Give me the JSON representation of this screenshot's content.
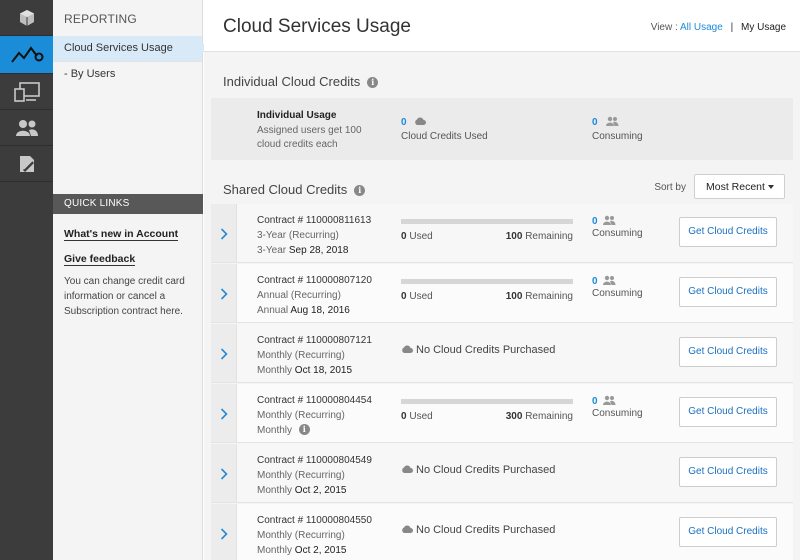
{
  "header": {
    "title": "Cloud Services Usage"
  },
  "view": {
    "prefix": "View :",
    "all_usage": "All Usage",
    "separator": "|",
    "my_usage": "My Usage"
  },
  "nav": {
    "heading": "REPORTING",
    "items": [
      {
        "label": "Cloud Services Usage"
      },
      {
        "label": "- By Users"
      }
    ],
    "quick_links": {
      "heading": "QUICK LINKS",
      "whats_new": "What's new in Account",
      "feedback": "Give feedback",
      "text": "You can change credit card information or cancel a Subscription contract here."
    }
  },
  "rail_icons": [
    "box-icon",
    "activity-icon",
    "devices-icon",
    "users-icon",
    "document-edit-icon"
  ],
  "individual": {
    "title": "Individual Cloud Credits",
    "label": "Individual Usage",
    "description": "Assigned users get 100 cloud credits each",
    "used_value": "0",
    "used_label": "Cloud Credits Used",
    "consuming_value": "0",
    "consuming_label": "Consuming"
  },
  "shared": {
    "title": "Shared Cloud Credits",
    "sort_label": "Sort by",
    "sort_value": "Most Recent",
    "rows": [
      {
        "contract": "Contract # 110000811613",
        "term": "3-Year (Recurring)",
        "date_prefix": "3-Year",
        "date": "Sep 28, 2018",
        "used": "0",
        "used_label": "Used",
        "remaining": "100",
        "remaining_label": "Remaining",
        "consuming": "0",
        "consuming_label": "Consuming",
        "button": "Get Cloud Credits"
      },
      {
        "contract": "Contract # 110000807120",
        "term": "Annual (Recurring)",
        "date_prefix": "Annual",
        "date": "Aug 18, 2016",
        "used": "0",
        "used_label": "Used",
        "remaining": "100",
        "remaining_label": "Remaining",
        "consuming": "0",
        "consuming_label": "Consuming",
        "button": "Get Cloud Credits"
      },
      {
        "contract": "Contract # 110000807121",
        "term": "Monthly (Recurring)",
        "date_prefix": "Monthly",
        "date": "Oct 18, 2015",
        "no_credits": "No Cloud Credits Purchased",
        "button": "Get Cloud Credits"
      },
      {
        "contract": "Contract # 110000804454",
        "term": "Monthly (Recurring)",
        "date_prefix": "Monthly",
        "date": "",
        "used": "0",
        "used_label": "Used",
        "remaining": "300",
        "remaining_label": "Remaining",
        "consuming": "0",
        "consuming_label": "Consuming",
        "button": "Get Cloud Credits"
      },
      {
        "contract": "Contract # 110000804549",
        "term": "Monthly (Recurring)",
        "date_prefix": "Monthly",
        "date": "Oct 2, 2015",
        "no_credits": "No Cloud Credits Purchased",
        "button": "Get Cloud Credits"
      },
      {
        "contract": "Contract # 110000804550",
        "term": "Monthly (Recurring)",
        "date_prefix": "Monthly",
        "date": "Oct 2, 2015",
        "no_credits": "No Cloud Credits Purchased",
        "button": "Get Cloud Credits"
      }
    ]
  }
}
